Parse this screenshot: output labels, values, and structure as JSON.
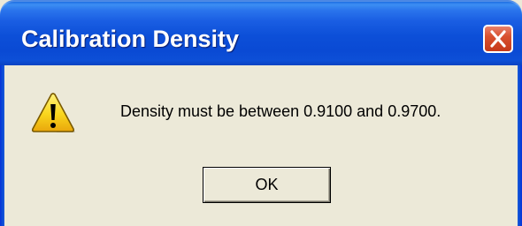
{
  "window": {
    "title": "Calibration Density",
    "close_icon": "close-x-icon"
  },
  "dialog": {
    "icon": "warning-triangle-icon",
    "message": "Density must be between 0.9100 and 0.9700.",
    "ok_label": "OK"
  },
  "colors": {
    "titlebar_blue": "#0c4fd8",
    "close_red": "#d9512f",
    "dialog_face": "#ece9d8",
    "warning_yellow": "#f9d51c"
  }
}
